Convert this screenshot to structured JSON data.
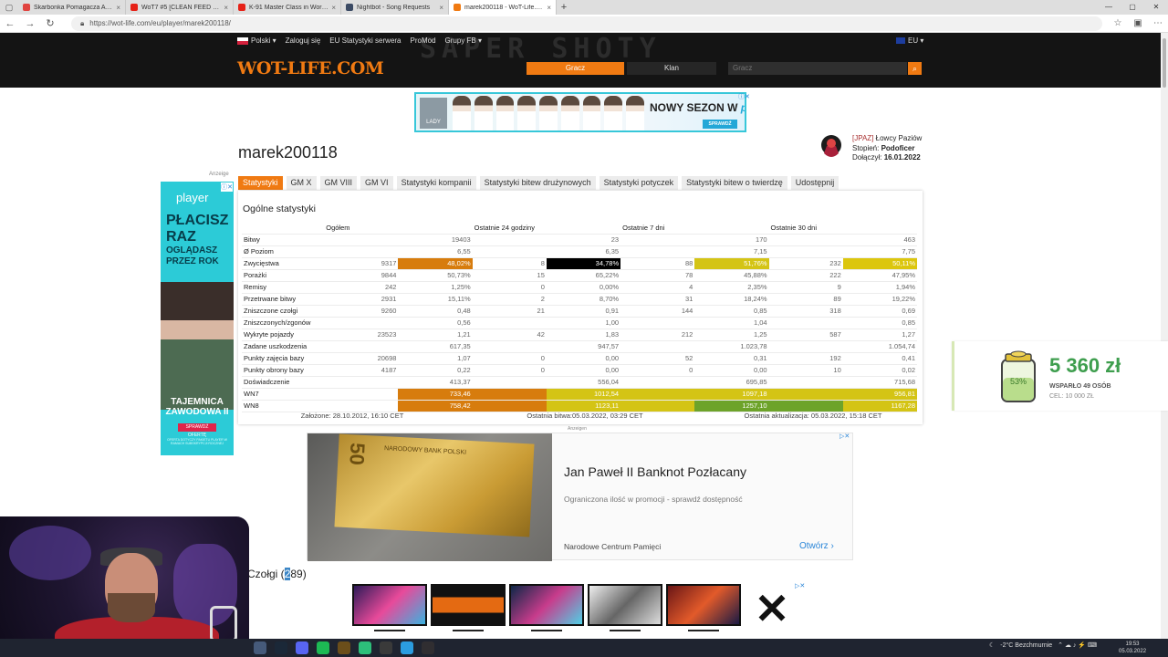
{
  "browser": {
    "tabs": [
      {
        "label": "Skarbonka Pomagacza Anonimow...",
        "color": "#e0433f"
      },
      {
        "label": "WoT7 #5 [CLEAN FEED DAY #1] ...",
        "color": "#e62117"
      },
      {
        "label": "K-91 Master Class in World of Ta...",
        "color": "#e62117"
      },
      {
        "label": "Nightbot - Song Requests",
        "color": "#3b4a64"
      },
      {
        "label": "marek200118 - WoT-Life.com - ...",
        "color": "#f07a12"
      }
    ],
    "url": "https://wot-life.com/eu/player/marek200118/"
  },
  "site": {
    "nav": [
      "Polski ▾",
      "Zaloguj się",
      "EU Statystyki serwera",
      "ProMod",
      "Grupy FB ▾"
    ],
    "region": "EU ▾",
    "logo": "WOT-LIFE.COM",
    "ghost": "SAPER SHOTY",
    "btn_player": "Gracz",
    "btn_clan": "Klan",
    "search_placeholder": "Gracz",
    "search_icon": "⌕"
  },
  "banner_top": {
    "lady": "LADY",
    "slogan_a": "NOWY SEZON W ",
    "slogan_b": "player",
    "cta": "SPRAWDŹ"
  },
  "player": {
    "name": "marek200118",
    "clan_tag": "[JPAZ]",
    "clan_name": " Łowcy Paziów",
    "rank_label": "Stopień: ",
    "rank": "Podoficer",
    "joined_label": "Dołączył: ",
    "joined": "16.01.2022"
  },
  "tabs": [
    "Statystyki",
    "GM X",
    "GM VIII",
    "GM VI",
    "Statystyki kompanii",
    "Statystyki bitew drużynowych",
    "Statystyki potyczek",
    "Statystyki bitew o twierdzę",
    "Udostępnij"
  ],
  "stats": {
    "title": "Ogólne statystyki",
    "headers": [
      "",
      "Ogółem",
      "",
      "Ostatnie 24 godziny",
      "",
      "Ostatnie 7 dni",
      "",
      "Ostatnie 30 dni",
      ""
    ],
    "rows": [
      {
        "label": "Bitwy",
        "cells": [
          "",
          "19403",
          "",
          "23",
          "",
          "170",
          "",
          "463"
        ]
      },
      {
        "label": "Ø Poziom",
        "cells": [
          "",
          "6,55",
          "",
          "6,35",
          "",
          "7,15",
          "",
          "7,75"
        ]
      },
      {
        "label": "Zwycięstwa",
        "cells": [
          "9317",
          "48,02%",
          "8",
          "34,78%",
          "88",
          "51,76%",
          "232",
          "50,11%"
        ]
      },
      {
        "label": "Porażki",
        "cells": [
          "9844",
          "50,73%",
          "15",
          "65,22%",
          "78",
          "45,88%",
          "222",
          "47,95%"
        ]
      },
      {
        "label": "Remisy",
        "cells": [
          "242",
          "1,25%",
          "0",
          "0,00%",
          "4",
          "2,35%",
          "9",
          "1,94%"
        ]
      },
      {
        "label": "Przetrwane bitwy",
        "cells": [
          "2931",
          "15,11%",
          "2",
          "8,70%",
          "31",
          "18,24%",
          "89",
          "19,22%"
        ]
      },
      {
        "label": "Zniszczone czołgi",
        "cells": [
          "9260",
          "0,48",
          "21",
          "0,91",
          "144",
          "0,85",
          "318",
          "0,69"
        ]
      },
      {
        "label": "Zniszczonych/zgonów",
        "cells": [
          "",
          "0,56",
          "",
          "1,00",
          "",
          "1,04",
          "",
          "0,85"
        ]
      },
      {
        "label": "Wykryte pojazdy",
        "cells": [
          "23523",
          "1,21",
          "42",
          "1,83",
          "212",
          "1,25",
          "587",
          "1,27"
        ]
      },
      {
        "label": "Zadane uszkodzenia",
        "cells": [
          "",
          "617,35",
          "",
          "947,57",
          "",
          "1.023,78",
          "",
          "1.054,74"
        ]
      },
      {
        "label": "Punkty zajęcia bazy",
        "cells": [
          "20698",
          "1,07",
          "0",
          "0,00",
          "52",
          "0,31",
          "192",
          "0,41"
        ]
      },
      {
        "label": "Punkty obrony bazy",
        "cells": [
          "4187",
          "0,22",
          "0",
          "0,00",
          "0",
          "0,00",
          "10",
          "0,02"
        ]
      },
      {
        "label": "Doświadczenie",
        "cells": [
          "",
          "413,37",
          "",
          "556,04",
          "",
          "695,85",
          "",
          "715,68"
        ]
      },
      {
        "label": "WN7",
        "cells": [
          "",
          "733,46",
          "",
          "1012,54",
          "",
          "1097,18",
          "",
          "956,81"
        ]
      },
      {
        "label": "WN8",
        "cells": [
          "",
          "758,42",
          "",
          "1123,11",
          "",
          "1257,10",
          "",
          "1167,28"
        ]
      }
    ],
    "highlight_colors": {
      "orange": "#d77c0d",
      "black": "#000000",
      "yellow": "#d4c415",
      "yellow_bright": "#dcc60e",
      "green": "#6da32a"
    },
    "footer": {
      "founded": "Założone: 28.10.2012, 16:10 CET",
      "last_battle": "Ostatnia bitwa:05.03.2022, 03:29 CET",
      "last_update": "Ostatnia aktualizacja: 05.03.2022, 15:18 CET"
    }
  },
  "side_ad": {
    "anzeige": "Anzeige",
    "brand": "player",
    "l1": "PŁACISZ",
    "l2": "RAZ",
    "l3": "OGLĄDASZ",
    "l4": "PRZEZ ROK",
    "l5": "TAJEMNICA",
    "l6": "ZAWODOWA II",
    "btn": "SPRAWDŹ OFERTĘ",
    "small": "OFERTA DOTYCZY PAKIETU PLAYER W RAMACH SUBSKRYPCJI ROCZNEJ"
  },
  "donate": {
    "amount": "5 360 zł",
    "percent": "53%",
    "supported": "WSPARŁO 49 OSÓB",
    "goal": "CEL: 10 000 ZŁ"
  },
  "note_ad": {
    "anzeige": "Anzeigen",
    "denomination": "50",
    "bank": "NARODOWY BANK POLSKI",
    "headline": "Jan Paweł II Banknot Pozłacany",
    "desc": "Ograniczona ilość w promocji - sprawdź dostępność",
    "source": "Narodowe Centrum Pamięci",
    "open": "Otwórz ›"
  },
  "tanks": {
    "label_a": "Czołgi (",
    "label_sel": "2",
    "label_b": "89)"
  },
  "taskbar": {
    "weather": "-2°C  Bezchmurnie",
    "time": "19:53",
    "date": "05.03.2022"
  }
}
